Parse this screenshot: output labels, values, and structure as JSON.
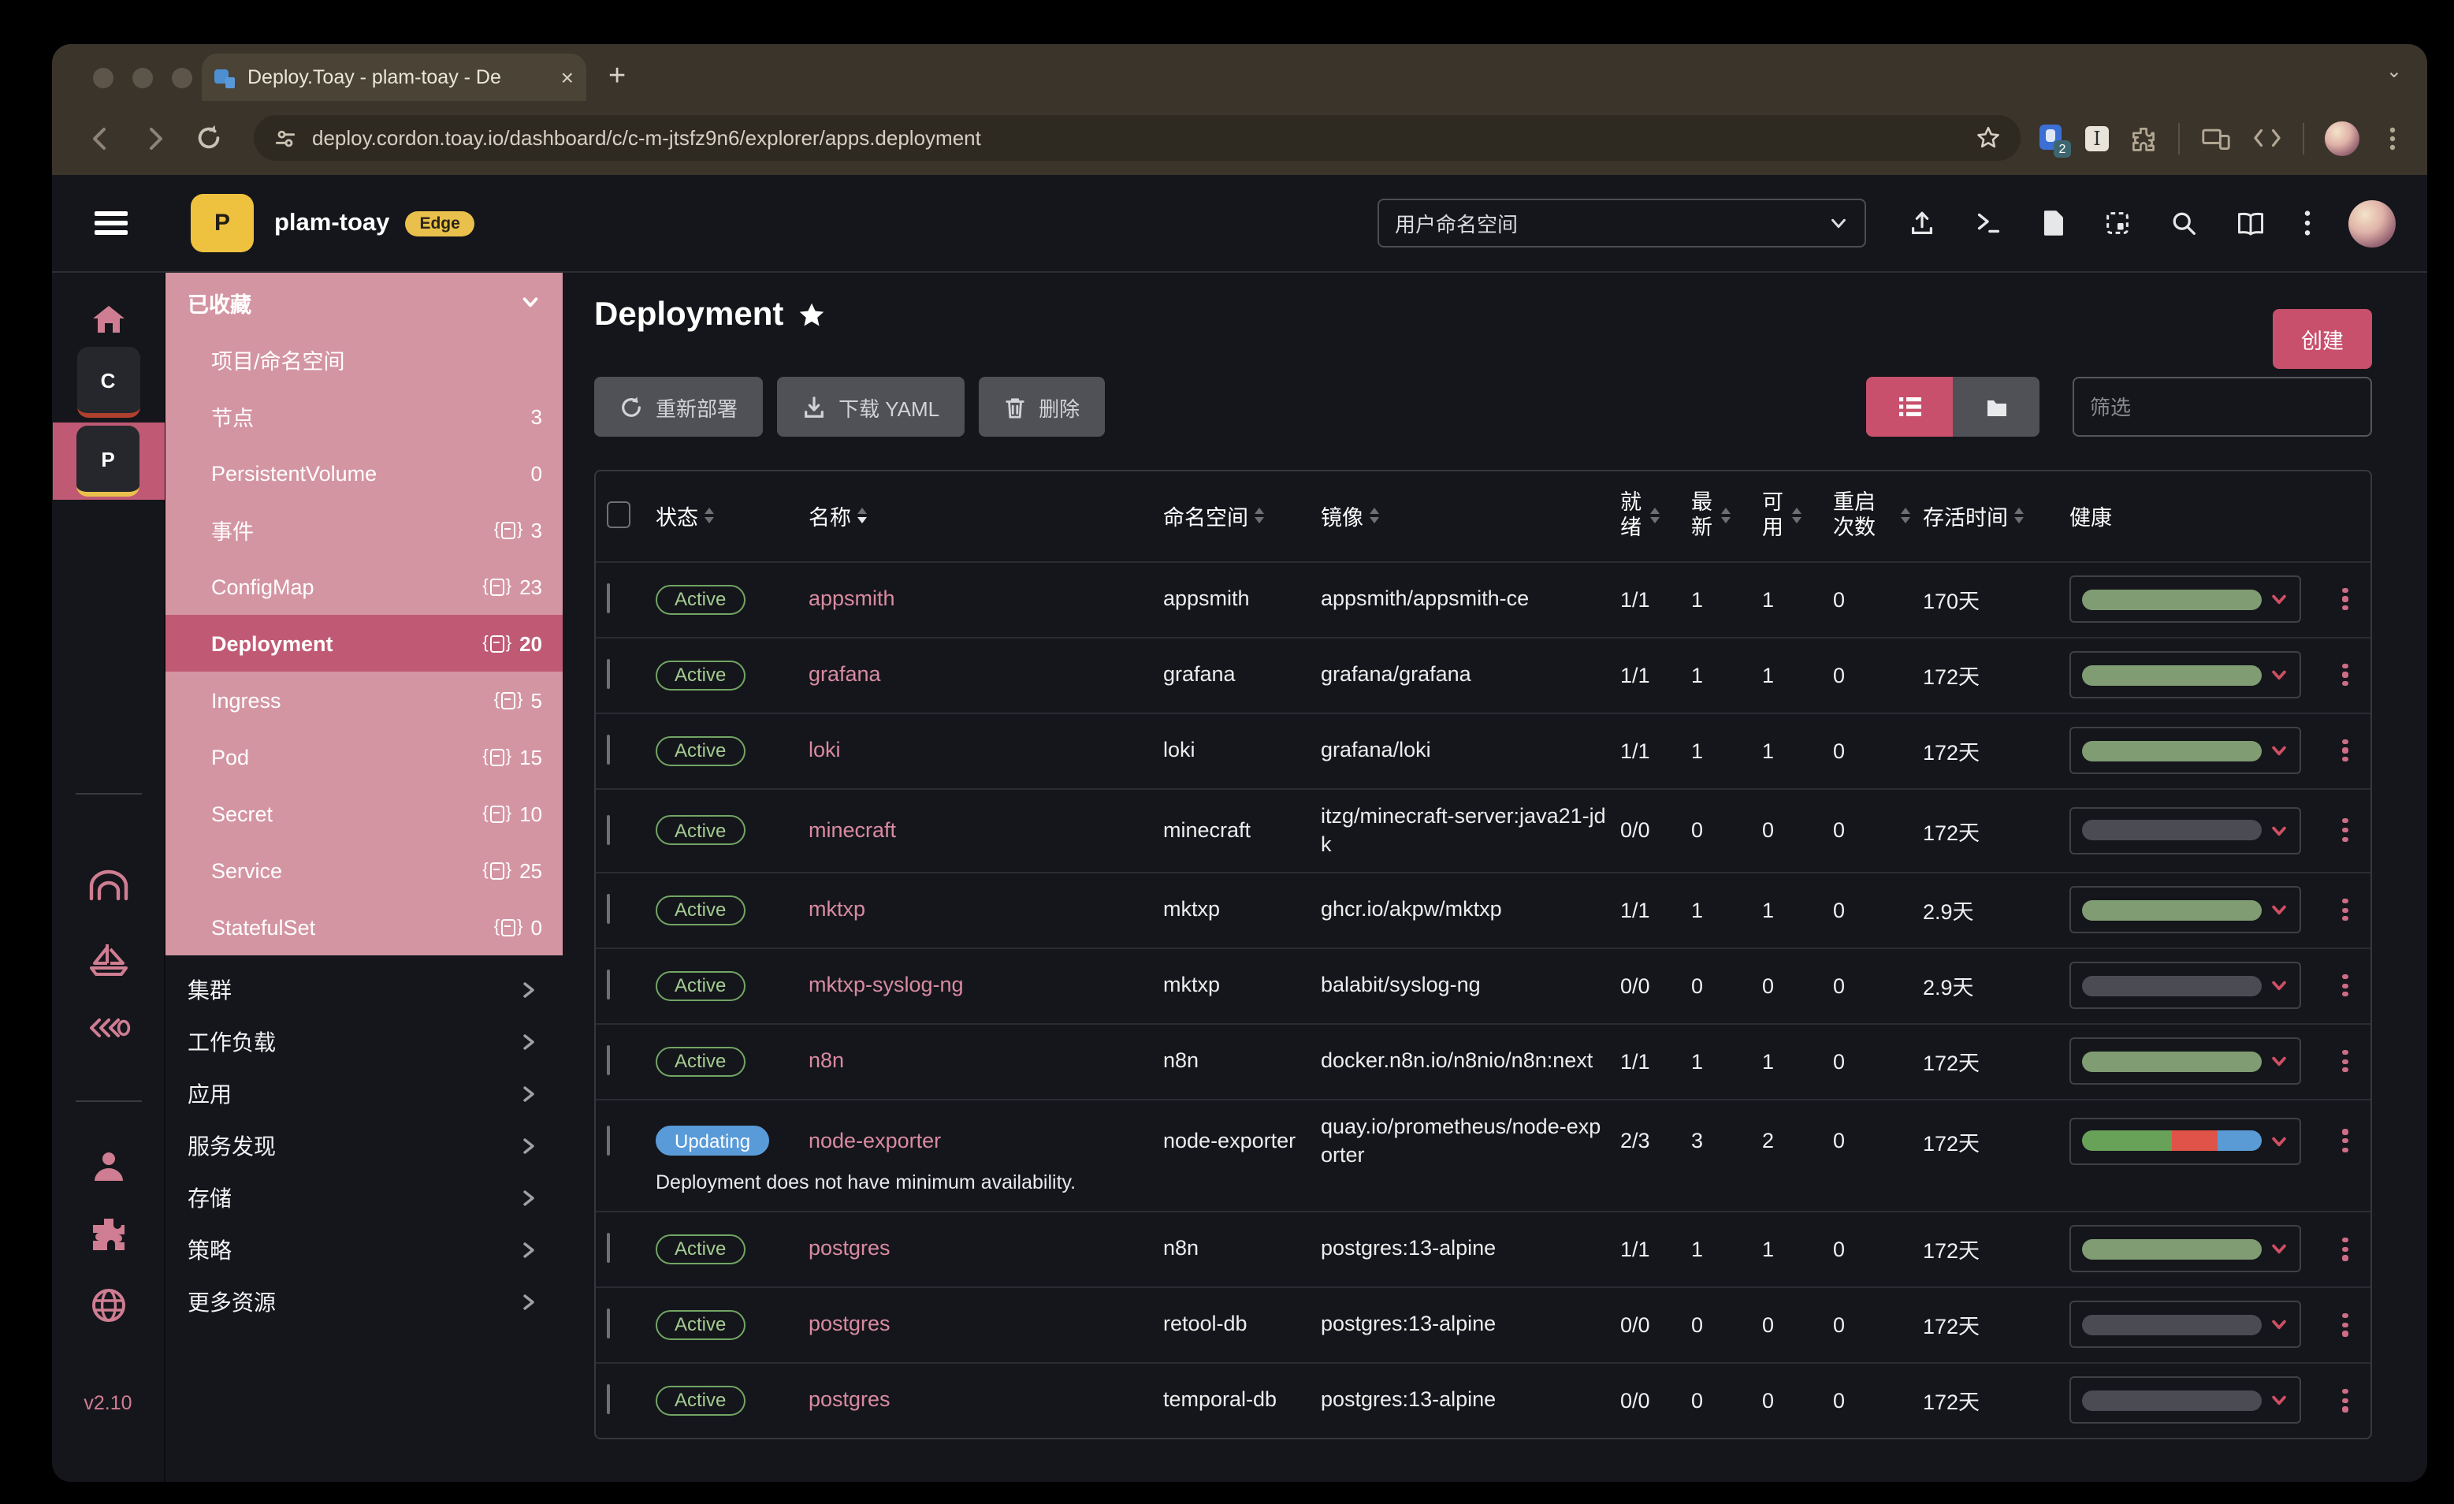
{
  "browser": {
    "tab_title": "Deploy.Toay - plam-toay - De",
    "url": "deploy.cordon.toay.io/dashboard/c/c-m-jtsfz9n6/explorer/apps.deployment",
    "extension_badge": "2",
    "new_tab": "+",
    "close_tab": "×"
  },
  "header": {
    "project_initial": "P",
    "project_name": "plam-toay",
    "edge_badge": "Edge",
    "namespace_filter": "用户命名空间"
  },
  "rail": {
    "cluster_c": "C",
    "cluster_p": "P",
    "version": "v2.10"
  },
  "sidebar": {
    "favorites_title": "已收藏",
    "favorites": [
      {
        "label": "项目/命名空间",
        "count": "",
        "namespaced": false,
        "selected": false
      },
      {
        "label": "节点",
        "count": "3",
        "namespaced": false,
        "selected": false
      },
      {
        "label": "PersistentVolume",
        "count": "0",
        "namespaced": false,
        "selected": false
      },
      {
        "label": "事件",
        "count": "3",
        "namespaced": true,
        "selected": false
      },
      {
        "label": "ConfigMap",
        "count": "23",
        "namespaced": true,
        "selected": false
      },
      {
        "label": "Deployment",
        "count": "20",
        "namespaced": true,
        "selected": true
      },
      {
        "label": "Ingress",
        "count": "5",
        "namespaced": true,
        "selected": false
      },
      {
        "label": "Pod",
        "count": "15",
        "namespaced": true,
        "selected": false
      },
      {
        "label": "Secret",
        "count": "10",
        "namespaced": true,
        "selected": false
      },
      {
        "label": "Service",
        "count": "25",
        "namespaced": true,
        "selected": false
      },
      {
        "label": "StatefulSet",
        "count": "0",
        "namespaced": true,
        "selected": false
      }
    ],
    "groups": [
      "集群",
      "工作负载",
      "应用",
      "服务发现",
      "存储",
      "策略",
      "更多资源"
    ]
  },
  "page": {
    "title": "Deployment",
    "favorited": true,
    "create_label": "创建",
    "actions": [
      "重新部署",
      "下载 YAML",
      "删除"
    ],
    "filter_placeholder": "筛选"
  },
  "table": {
    "headers": {
      "status": "状态",
      "name": "名称",
      "namespace": "命名空间",
      "image": "镜像",
      "ready": "就绪",
      "up_to_date": "最新",
      "available": "可用",
      "restarts": "重启次数",
      "age": "存活时间",
      "health": "健康"
    },
    "rows": [
      {
        "state": "Active",
        "name": "appsmith",
        "namespace": "appsmith",
        "image": "appsmith/appsmith-ce",
        "ready": "1/1",
        "up_to_date": "1",
        "available": "1",
        "restarts": "0",
        "age": "170天",
        "health": [
          {
            "c": "#7f9c72",
            "w": 100
          }
        ],
        "note": ""
      },
      {
        "state": "Active",
        "name": "grafana",
        "namespace": "grafana",
        "image": "grafana/grafana",
        "ready": "1/1",
        "up_to_date": "1",
        "available": "1",
        "restarts": "0",
        "age": "172天",
        "health": [
          {
            "c": "#7f9c72",
            "w": 100
          }
        ],
        "note": ""
      },
      {
        "state": "Active",
        "name": "loki",
        "namespace": "loki",
        "image": "grafana/loki",
        "ready": "1/1",
        "up_to_date": "1",
        "available": "1",
        "restarts": "0",
        "age": "172天",
        "health": [
          {
            "c": "#7f9c72",
            "w": 100
          }
        ],
        "note": ""
      },
      {
        "state": "Active",
        "name": "minecraft",
        "namespace": "minecraft",
        "image": "itzg/minecraft-server:java21-jdk",
        "ready": "0/0",
        "up_to_date": "0",
        "available": "0",
        "restarts": "0",
        "age": "172天",
        "health": [
          {
            "c": "#4b4b54",
            "w": 100
          }
        ],
        "note": ""
      },
      {
        "state": "Active",
        "name": "mktxp",
        "namespace": "mktxp",
        "image": "ghcr.io/akpw/mktxp",
        "ready": "1/1",
        "up_to_date": "1",
        "available": "1",
        "restarts": "0",
        "age": "2.9天",
        "health": [
          {
            "c": "#7f9c72",
            "w": 100
          }
        ],
        "note": ""
      },
      {
        "state": "Active",
        "name": "mktxp-syslog-ng",
        "namespace": "mktxp",
        "image": "balabit/syslog-ng",
        "ready": "0/0",
        "up_to_date": "0",
        "available": "0",
        "restarts": "0",
        "age": "2.9天",
        "health": [
          {
            "c": "#4b4b54",
            "w": 100
          }
        ],
        "note": ""
      },
      {
        "state": "Active",
        "name": "n8n",
        "namespace": "n8n",
        "image": "docker.n8n.io/n8nio/n8n:next",
        "ready": "1/1",
        "up_to_date": "1",
        "available": "1",
        "restarts": "0",
        "age": "172天",
        "health": [
          {
            "c": "#7f9c72",
            "w": 100
          }
        ],
        "note": ""
      },
      {
        "state": "Updating",
        "name": "node-exporter",
        "namespace": "node-exporter",
        "image": "quay.io/prometheus/node-exporter",
        "ready": "2/3",
        "up_to_date": "3",
        "available": "2",
        "restarts": "0",
        "age": "172天",
        "health": [
          {
            "c": "#68a259",
            "w": 50
          },
          {
            "c": "#df5348",
            "w": 25
          },
          {
            "c": "#5b9bd5",
            "w": 25
          }
        ],
        "note": "Deployment does not have minimum availability."
      },
      {
        "state": "Active",
        "name": "postgres",
        "namespace": "n8n",
        "image": "postgres:13-alpine",
        "ready": "1/1",
        "up_to_date": "1",
        "available": "1",
        "restarts": "0",
        "age": "172天",
        "health": [
          {
            "c": "#7f9c72",
            "w": 100
          }
        ],
        "note": ""
      },
      {
        "state": "Active",
        "name": "postgres",
        "namespace": "retool-db",
        "image": "postgres:13-alpine",
        "ready": "0/0",
        "up_to_date": "0",
        "available": "0",
        "restarts": "0",
        "age": "172天",
        "health": [
          {
            "c": "#4b4b54",
            "w": 100
          }
        ],
        "note": ""
      },
      {
        "state": "Active",
        "name": "postgres",
        "namespace": "temporal-db",
        "image": "postgres:13-alpine",
        "ready": "0/0",
        "up_to_date": "0",
        "available": "0",
        "restarts": "0",
        "age": "172天",
        "health": [
          {
            "c": "#4b4b54",
            "w": 100
          }
        ],
        "note": ""
      }
    ]
  },
  "colors": {
    "accent_pink": "#c8506c",
    "sidebar_pink": "#d495a3",
    "sidebar_selected": "#c05a74",
    "active_green_border": "#72a564",
    "updating_blue": "#599bd8",
    "link_pink": "#d98ba1",
    "edge_yellow": "#e9c04b",
    "health_green": "#7f9c72",
    "health_gray": "#4b4b54",
    "health_red": "#df5348",
    "health_blue": "#5b9bd5"
  },
  "icons": {
    "chrome": [
      "back-arrow",
      "forward-arrow",
      "reload",
      "site-settings",
      "bookmark-star",
      "extension-shield",
      "extension-i",
      "extensions-puzzle",
      "devices",
      "code",
      "profile-avatar",
      "menu-kebab"
    ],
    "app_header": [
      "hamburger-menu",
      "import-yaml",
      "kubectl-shell",
      "download-kubeconfig",
      "copy-kubeconfig",
      "search",
      "docs-book",
      "menu-kebab",
      "user-avatar"
    ],
    "rail": [
      "home",
      "cluster-c",
      "cluster-p",
      "hangar",
      "fleet-boat",
      "harvester-wheat",
      "users",
      "extensions-puzzle",
      "globe"
    ]
  }
}
